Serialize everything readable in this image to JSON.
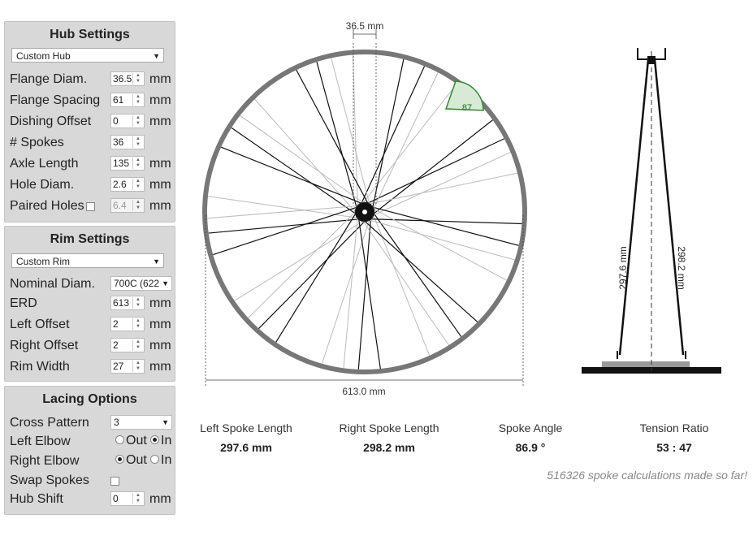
{
  "hub": {
    "title": "Hub Settings",
    "preset": "Custom Hub",
    "flange_diam_label": "Flange Diam.",
    "flange_diam": "36.5",
    "flange_spacing_label": "Flange Spacing",
    "flange_spacing": "61",
    "dishing_offset_label": "Dishing Offset",
    "dishing_offset": "0",
    "spokes_label": "# Spokes",
    "spokes": "36",
    "axle_length_label": "Axle Length",
    "axle_length": "135",
    "hole_diam_label": "Hole Diam.",
    "hole_diam": "2.6",
    "paired_holes_label": "Paired Holes",
    "paired_holes": "6.4",
    "unit": "mm"
  },
  "rim": {
    "title": "Rim Settings",
    "preset": "Custom Rim",
    "nominal_label": "Nominal Diam.",
    "nominal": "700C (622",
    "erd_label": "ERD",
    "erd": "613",
    "left_offset_label": "Left Offset",
    "left_offset": "2",
    "right_offset_label": "Right Offset",
    "right_offset": "2",
    "rim_width_label": "Rim Width",
    "rim_width": "27",
    "unit": "mm"
  },
  "lacing": {
    "title": "Lacing Options",
    "cross_label": "Cross Pattern",
    "cross": "3",
    "left_elbow_label": "Left Elbow",
    "right_elbow_label": "Right Elbow",
    "out_label": "Out",
    "in_label": "In",
    "swap_label": "Swap Spokes",
    "hub_shift_label": "Hub Shift",
    "hub_shift": "0",
    "unit": "mm"
  },
  "diagram": {
    "flange_dim": "36.5 mm",
    "erd_dim": "613.0 mm",
    "angle": "87",
    "left_len_dim": "297.6 mm",
    "right_len_dim": "298.2 mm"
  },
  "results": {
    "left_title": "Left Spoke Length",
    "left_value": "297.6 mm",
    "right_title": "Right Spoke Length",
    "right_value": "298.2 mm",
    "angle_title": "Spoke Angle",
    "angle_value": "86.9 °",
    "tension_title": "Tension Ratio",
    "tension_value": "53 : 47"
  },
  "footer": "516326 spoke calculations made so far!",
  "colors": {
    "panel_bg": "#d8d8d8",
    "rim": "#777777",
    "angle_fill": "#d6ead6",
    "angle_stroke": "#2e8b2e"
  }
}
